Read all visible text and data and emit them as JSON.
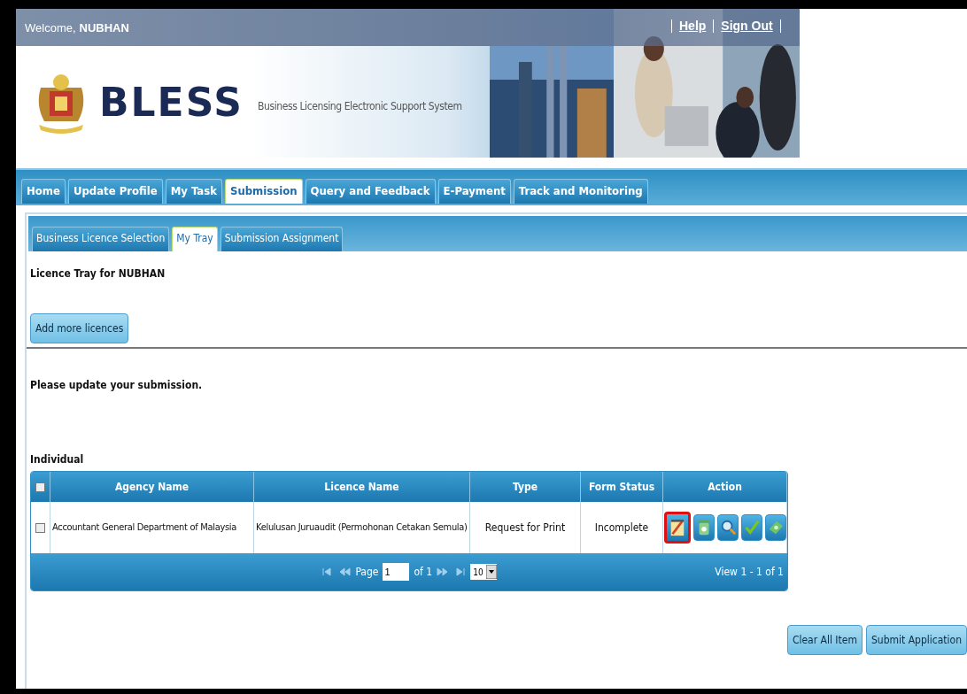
{
  "header": {
    "welcome_label": "Welcome,",
    "user": "NUBHAN",
    "links": [
      "Help",
      "Sign Out"
    ],
    "logo": "BLESS",
    "tagline": "Business Licensing Electronic Support System",
    "banner": {
      "kind": "picture"
    }
  },
  "main_tabs": [
    {
      "label": "Home",
      "selected": false
    },
    {
      "label": "Update Profile",
      "selected": false
    },
    {
      "label": "My Task",
      "selected": false
    },
    {
      "label": "Submission",
      "selected": true
    },
    {
      "label": "Query and Feedback",
      "selected": false
    },
    {
      "label": "E-Payment",
      "selected": false
    },
    {
      "label": "Track and Monitoring",
      "selected": false
    }
  ],
  "sub_tabs": [
    {
      "label": "Business Licence Selection",
      "selected": false
    },
    {
      "label": "My Tray",
      "selected": true
    },
    {
      "label": "Submission Assignment",
      "selected": false
    }
  ],
  "tray_title": "Licence Tray for NUBHAN",
  "add_button": "Add more licences",
  "message": "Please update your submission.",
  "section_title": "Individual",
  "table": {
    "select_all_checked": false,
    "columns": [
      "Agency Name",
      "Licence Name",
      "Type",
      "Form Status",
      "Action"
    ],
    "rows": [
      {
        "checked": false,
        "cells": [
          "Accountant General Department of Malaysia",
          "Kelulusan Juruaudit (Permohonan Cetakan Semula)",
          "Request for Print",
          "Incomplete"
        ],
        "actions": [
          {
            "kind": "edit",
            "highlighted": true
          },
          {
            "kind": "delete",
            "highlighted": false
          },
          {
            "kind": "view",
            "highlighted": false
          },
          {
            "kind": "approve",
            "highlighted": false
          },
          {
            "kind": "pay",
            "highlighted": false
          }
        ]
      }
    ],
    "pager": {
      "page_label": "Page",
      "page": "1",
      "of_label": "of 1",
      "page_size": "10",
      "view_info": "View 1 - 1 of 1"
    }
  },
  "footer_buttons": [
    "Clear All Item",
    "Submit Application"
  ]
}
